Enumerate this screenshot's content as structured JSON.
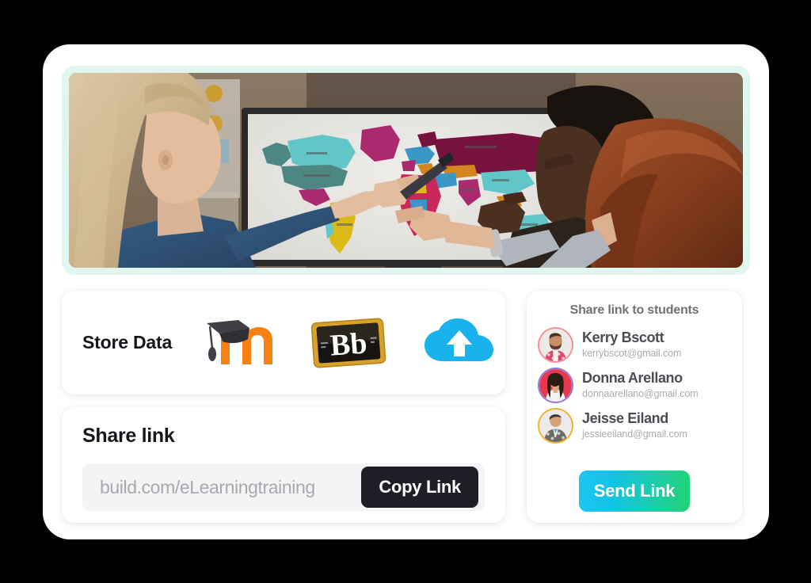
{
  "hero": {
    "alt": "Three colleagues pointing at a world map displayed on a large wall screen in a classroom",
    "icon": "classroom-world-map-photo"
  },
  "store": {
    "label": "Store Data",
    "platforms": [
      {
        "name": "Moodle",
        "icon": "moodle-logo"
      },
      {
        "name": "Blackboard",
        "icon": "blackboard-logo"
      },
      {
        "name": "Cloud Upload",
        "icon": "cloud-upload-icon"
      }
    ]
  },
  "share": {
    "title": "Share link",
    "link_value": "build.com/eLearningtraining",
    "link_placeholder": "build.com/eLearningtraining",
    "copy_label": "Copy Link"
  },
  "students": {
    "title": "Share link to students",
    "list": [
      {
        "name": "Kerry Bscott",
        "email": "kerrybscot@gmail.com",
        "ring": "ring-pink",
        "avatar": "avatar-kerry"
      },
      {
        "name": "Donna Arellano",
        "email": "donnaarellano@gmail.com",
        "ring": "ring-purple",
        "avatar": "avatar-donna"
      },
      {
        "name": "Jeisse Eiland",
        "email": "jessieeiland@gmail.com",
        "ring": "ring-gold",
        "avatar": "avatar-jeisse"
      }
    ],
    "send_label": "Send Link"
  },
  "colors": {
    "background": "#000000",
    "shell": "#ffffff",
    "hero_frame": "#e2f6f0",
    "copy_button": "#1d1e26",
    "send_gradient_start": "#1ec6f0",
    "send_gradient_end": "#21d271",
    "input_background": "#f3f4f5",
    "muted_text": "#a9abb0",
    "heading_text": "#14161c"
  }
}
